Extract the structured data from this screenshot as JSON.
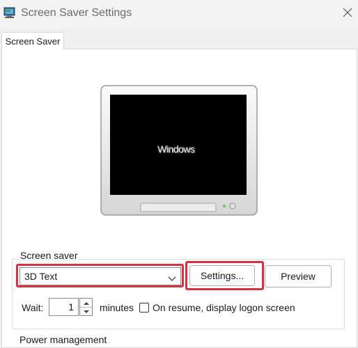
{
  "window": {
    "title": "Screen Saver Settings",
    "icon": "monitor-app-icon",
    "close_icon": "close-icon"
  },
  "tabs": [
    {
      "label": "Screen Saver",
      "active": true
    }
  ],
  "preview": {
    "screen_text": "Windows"
  },
  "screen_saver_group": {
    "label": "Screen saver",
    "selected": "3D Text",
    "settings_label": "Settings...",
    "preview_label": "Preview",
    "wait_label": "Wait:",
    "wait_value": "1",
    "minutes_label": "minutes",
    "resume_label": "On resume, display logon screen",
    "resume_checked": false
  },
  "next_group": {
    "label": "Power management"
  },
  "highlight_color": "#d8303c"
}
